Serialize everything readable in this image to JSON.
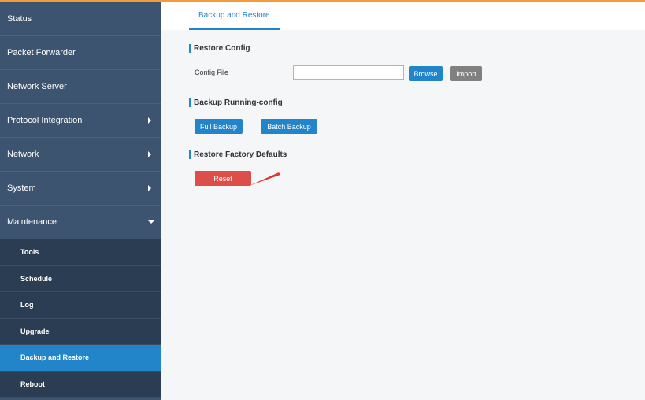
{
  "sidebar": {
    "items": [
      {
        "label": "Status"
      },
      {
        "label": "Packet Forwarder"
      },
      {
        "label": "Network Server"
      },
      {
        "label": "Protocol Integration"
      },
      {
        "label": "Network"
      },
      {
        "label": "System"
      },
      {
        "label": "Maintenance"
      }
    ],
    "subitems": [
      {
        "label": "Tools"
      },
      {
        "label": "Schedule"
      },
      {
        "label": "Log"
      },
      {
        "label": "Upgrade"
      },
      {
        "label": "Backup and Restore"
      },
      {
        "label": "Reboot"
      }
    ]
  },
  "tabs": [
    {
      "label": "Backup and Restore"
    }
  ],
  "restore": {
    "title": "Restore Config",
    "config_file_label": "Config File",
    "config_file_value": "",
    "browse_label": "Browse",
    "import_label": "Import"
  },
  "backup": {
    "title": "Backup Running-config",
    "full_label": "Full Backup",
    "batch_label": "Batch Backup"
  },
  "factory": {
    "title": "Restore Factory Defaults",
    "reset_label": "Reset"
  },
  "colors": {
    "accent": "#2385c9",
    "sidebar": "#3d5470",
    "topbar": "#f39b3a",
    "reset": "#db4e4a"
  }
}
